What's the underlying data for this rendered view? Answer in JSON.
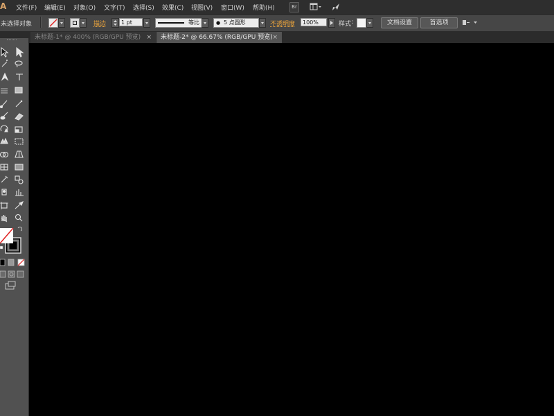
{
  "app": {
    "logo": "Ai"
  },
  "menu": [
    "文件(F)",
    "编辑(E)",
    "对象(O)",
    "文字(T)",
    "选择(S)",
    "效果(C)",
    "视图(V)",
    "窗口(W)",
    "帮助(H)"
  ],
  "menubar_buttons": {
    "bridge": "Br"
  },
  "control": {
    "selection_status": "未选择对象",
    "stroke_label": "描边",
    "stroke_weight": "1 pt",
    "stroke_profile": "等比",
    "brush": "5 点圆形",
    "opacity_label": "不透明度",
    "opacity_value": "100%",
    "style_label": "样式",
    "document_setup": "文档设置",
    "preferences": "首选项"
  },
  "tabs": [
    {
      "label": "未标题-1* @ 400% (RGB/GPU 预览)",
      "active": false
    },
    {
      "label": "未标题-2* @ 66.67% (RGB/GPU 预览)",
      "active": true
    }
  ],
  "colors": {
    "ui_bg": "#464646",
    "menubar_bg": "#2e2e2e",
    "toolbar_bg": "#515151",
    "canvas": "#000000",
    "accent_label": "#e8a23c",
    "none_swatch_line": "#e02020"
  }
}
